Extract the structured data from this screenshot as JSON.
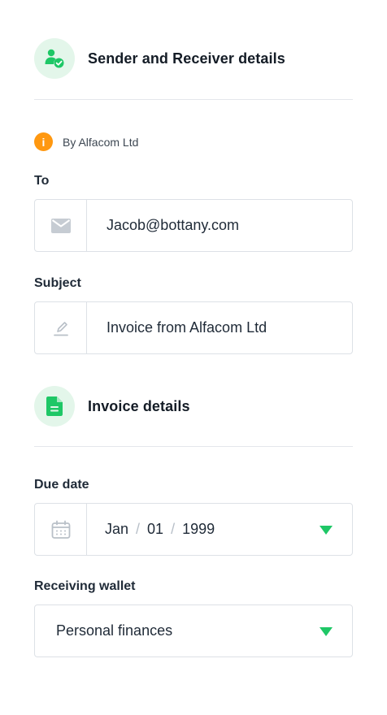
{
  "sender_section": {
    "title": "Sender and Receiver details",
    "icon": "user-check-icon"
  },
  "notice": {
    "icon": "info-icon",
    "badge": "i",
    "text": "By Alfacom Ltd"
  },
  "to_field": {
    "label": "To",
    "icon": "mail-icon",
    "value": "Jacob@bottany.com"
  },
  "subject_field": {
    "label": "Subject",
    "icon": "pencil-icon",
    "value": "Invoice from Alfacom Ltd"
  },
  "invoice_section": {
    "title": "Invoice details",
    "icon": "document-icon"
  },
  "due_date": {
    "label": "Due date",
    "icon": "calendar-icon",
    "month": "Jan",
    "day": "01",
    "year": "1999",
    "separator": "/"
  },
  "receiving_wallet": {
    "label": "Receiving wallet",
    "value": "Personal finances"
  },
  "colors": {
    "accent_green": "#1ec766",
    "icon_bg": "#e3f6ea",
    "info_orange": "#ff9810",
    "border": "#dde1e6"
  }
}
